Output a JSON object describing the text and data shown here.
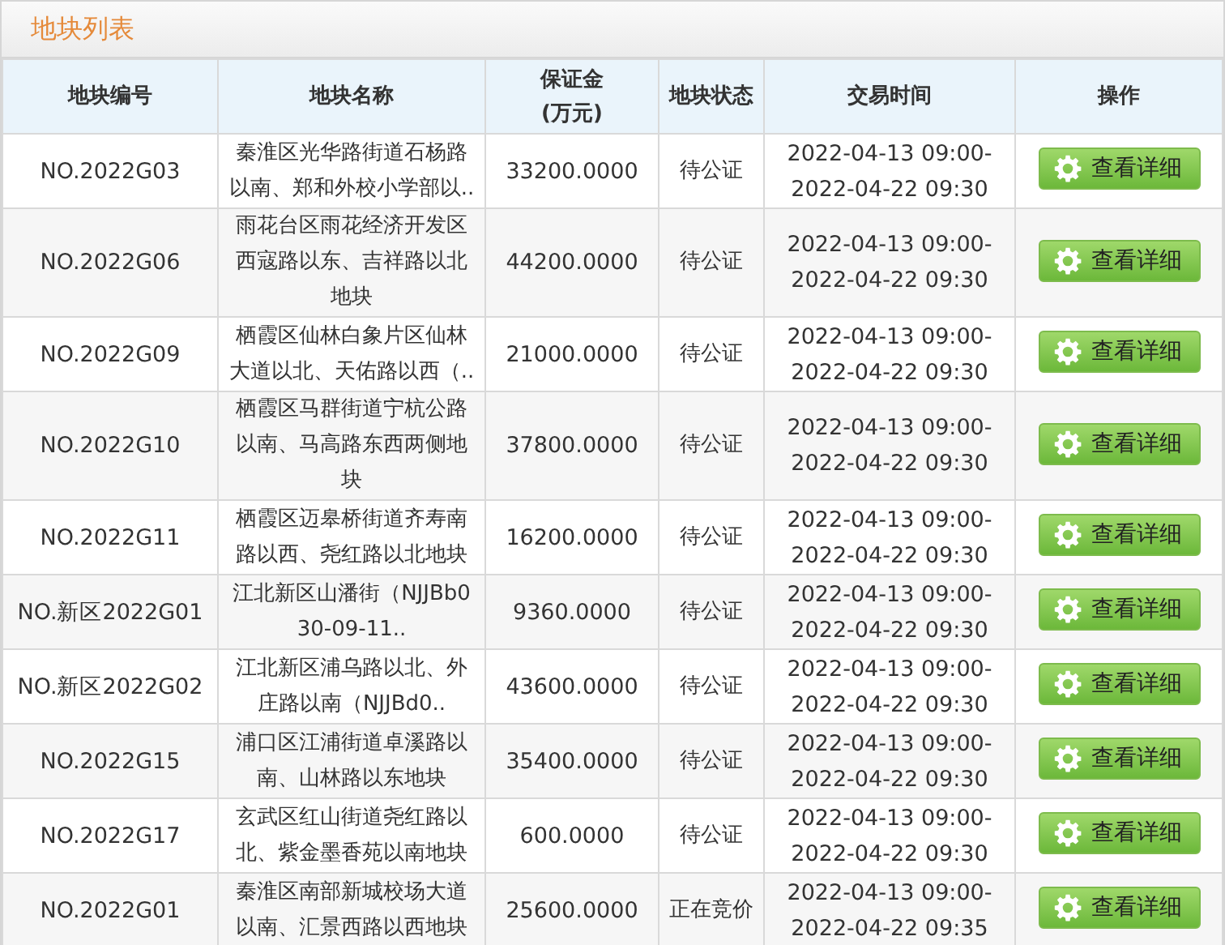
{
  "panel": {
    "title": "地块列表"
  },
  "table": {
    "columns": [
      "地块编号",
      "地块名称",
      "保证金\n(万元)",
      "地块状态",
      "交易时间",
      "操作"
    ],
    "rows": [
      {
        "code": "NO.2022G03",
        "name": "秦淮区光华路街道石杨路以南、郑和外校小学部以..",
        "deposit": "33200.0000",
        "status": "待公证",
        "time": [
          "2022-04-13 09:00-",
          "2022-04-22 09:30"
        ],
        "action": "查看详细"
      },
      {
        "code": "NO.2022G06",
        "name": "雨花台区雨花经济开发区西寇路以东、吉祥路以北地块",
        "deposit": "44200.0000",
        "status": "待公证",
        "time": [
          "2022-04-13 09:00-",
          "2022-04-22 09:30"
        ],
        "action": "查看详细"
      },
      {
        "code": "NO.2022G09",
        "name": "栖霞区仙林白象片区仙林大道以北、天佑路以西（..",
        "deposit": "21000.0000",
        "status": "待公证",
        "time": [
          "2022-04-13 09:00-",
          "2022-04-22 09:30"
        ],
        "action": "查看详细"
      },
      {
        "code": "NO.2022G10",
        "name": "栖霞区马群街道宁杭公路以南、马高路东西两侧地块",
        "deposit": "37800.0000",
        "status": "待公证",
        "time": [
          "2022-04-13 09:00-",
          "2022-04-22 09:30"
        ],
        "action": "查看详细"
      },
      {
        "code": "NO.2022G11",
        "name": "栖霞区迈皋桥街道齐寿南路以西、尧红路以北地块",
        "deposit": "16200.0000",
        "status": "待公证",
        "time": [
          "2022-04-13 09:00-",
          "2022-04-22 09:30"
        ],
        "action": "查看详细"
      },
      {
        "code": "NO.新区2022G01",
        "name": "江北新区山潘街（NJJBb030-09-11..",
        "deposit": "9360.0000",
        "status": "待公证",
        "time": [
          "2022-04-13 09:00-",
          "2022-04-22 09:30"
        ],
        "action": "查看详细"
      },
      {
        "code": "NO.新区2022G02",
        "name": "江北新区浦乌路以北、外庄路以南（NJJBd0..",
        "deposit": "43600.0000",
        "status": "待公证",
        "time": [
          "2022-04-13 09:00-",
          "2022-04-22 09:30"
        ],
        "action": "查看详细"
      },
      {
        "code": "NO.2022G15",
        "name": "浦口区江浦街道卓溪路以南、山林路以东地块",
        "deposit": "35400.0000",
        "status": "待公证",
        "time": [
          "2022-04-13 09:00-",
          "2022-04-22 09:30"
        ],
        "action": "查看详细"
      },
      {
        "code": "NO.2022G17",
        "name": "玄武区红山街道尧红路以北、紫金墨香苑以南地块",
        "deposit": "600.0000",
        "status": "待公证",
        "time": [
          "2022-04-13 09:00-",
          "2022-04-22 09:30"
        ],
        "action": "查看详细"
      },
      {
        "code": "NO.2022G01",
        "name": "秦淮区南部新城校场大道以南、汇景西路以西地块",
        "deposit": "25600.0000",
        "status": "正在竞价",
        "time": [
          "2022-04-13 09:00-",
          "2022-04-22 09:35"
        ],
        "action": "查看详细"
      }
    ]
  }
}
